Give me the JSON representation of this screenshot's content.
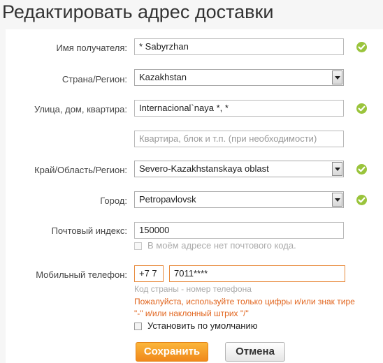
{
  "page_title": "Редактировать адрес доставки",
  "form": {
    "recipient": {
      "label": "Имя получателя:",
      "value": "* Sabyrzhan"
    },
    "country": {
      "label": "Страна/Регион:",
      "value": "Kazakhstan"
    },
    "street": {
      "label": "Улица, дом, квартира:",
      "value": "Internacional`naya *, *"
    },
    "apartment": {
      "placeholder": "Квартира, блок и т.п. (при необходимости)"
    },
    "region": {
      "label": "Край/Область/Регион:",
      "value": "Severo-Kazakhstanskaya oblast"
    },
    "city": {
      "label": "Город:",
      "value": "Petropavlovsk"
    },
    "zip": {
      "label": "Почтовый индекс:",
      "value": "150000",
      "no_zip_label": "В моём адресе нет почтового кода."
    },
    "phone": {
      "label": "Мобильный телефон:",
      "country_code": "+7 7",
      "number": "7011****",
      "hint": "Код страны - номер телефона",
      "error": "Пожалуйста, используйте только цифры и/или знак тире \"-\" и/или наклонный штрих \"/\""
    },
    "default_label": "Установить по умолчанию"
  },
  "buttons": {
    "save": "Сохранить",
    "cancel": "Отмена"
  },
  "colors": {
    "accent": "#f0891b",
    "error": "#e1651e",
    "valid": "#9ac43c"
  }
}
